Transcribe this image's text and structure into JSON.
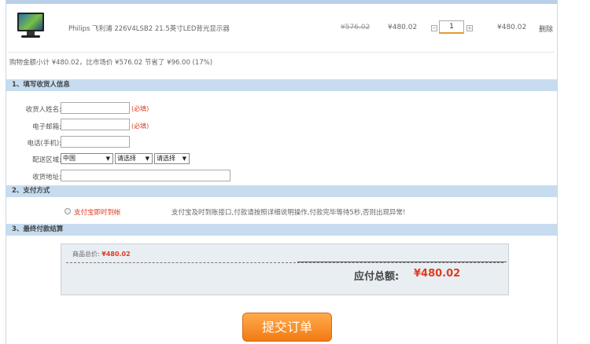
{
  "cart": {
    "product_name": "Philips 飞利浦 226V4LSB2 21.5英寸LED背光显示器",
    "market_price": "¥576.02",
    "our_price": "¥480.02",
    "quantity": "1",
    "qty_minus": "−",
    "qty_plus": "+",
    "subtotal": "¥480.02",
    "delete_label": "删除",
    "summary": "购物金额小计 ¥480.02，比市场价 ¥576.02 节省了 ¥96.00 (17%)"
  },
  "sections": {
    "receiver": "1、填写收货人信息",
    "payment": "2、支付方式",
    "final": "3、最终付款结算"
  },
  "receiver_form": {
    "name_label": "收货人姓名:",
    "email_label": "电子邮箱:",
    "phone_label": "电话(手机):",
    "region_label": "配送区域:",
    "address_label": "收货地址:",
    "required_mark": "(必填)",
    "name_value": "",
    "email_value": "",
    "phone_value": "",
    "address_value": "",
    "country_selected": "中国",
    "province_selected": "请选择",
    "city_selected": "请选择"
  },
  "payment": {
    "option_label": "支付宝即时到帐",
    "option_note": "支付宝及时到账接口,付款请按照详细说明操作,付款完毕等待5秒,否则出现异常!"
  },
  "final": {
    "goods_total_label": "商品总价:",
    "goods_total_value": "¥480.02",
    "payable_label": "应付总额:",
    "payable_value": "¥480.02"
  },
  "submit_label": "提交订单",
  "colors": {
    "section_bar": "#c7dcef",
    "accent_red": "#e03c1f",
    "button_orange": "#f27a13"
  }
}
